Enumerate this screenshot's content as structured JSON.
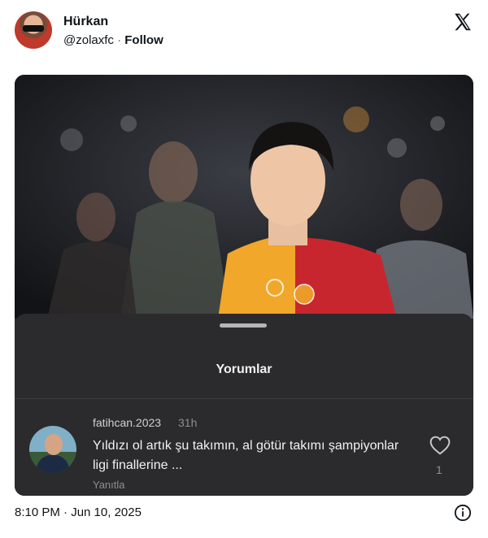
{
  "author": {
    "name": "Hürkan",
    "handle": "@zolaxfc",
    "separator": "·",
    "follow_label": "Follow"
  },
  "icons": {
    "logo": "x-logo-icon",
    "info": "info-icon",
    "like": "heart-icon"
  },
  "sheet": {
    "title": "Yorumlar"
  },
  "comment": {
    "username": "fatihcan.2023",
    "time": "31h",
    "text": "Yıldızı ol artık şu takımın, al götür takımı şampiyonlar ligi finallerine ...",
    "reply_label": "Yanıtla",
    "like_count": "1"
  },
  "timestamp": "8:10 PM · Jun 10, 2025",
  "colors": {
    "sheet_bg": "#2b2b2d",
    "jersey_red": "#c8262e",
    "jersey_yellow": "#f0a72a"
  }
}
